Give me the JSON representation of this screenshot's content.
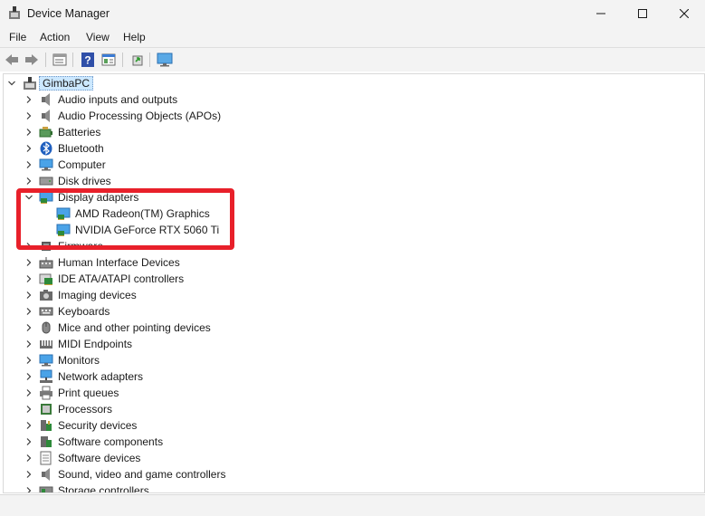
{
  "window": {
    "title": "Device Manager"
  },
  "menu": {
    "file": "File",
    "action": "Action",
    "view": "View",
    "help": "Help"
  },
  "toolbar": {
    "buttons": [
      "back-icon",
      "forward-icon",
      "properties-sheet-icon",
      "help-icon",
      "details-pane-icon",
      "update-driver-icon",
      "monitor-scan-icon"
    ]
  },
  "tree": {
    "root": "GimbaPC",
    "categories": [
      "Audio inputs and outputs",
      "Audio Processing Objects (APOs)",
      "Batteries",
      "Bluetooth",
      "Computer",
      "Disk drives",
      "Display adapters",
      "Firmware",
      "Human Interface Devices",
      "IDE ATA/ATAPI controllers",
      "Imaging devices",
      "Keyboards",
      "Mice and other pointing devices",
      "MIDI Endpoints",
      "Monitors",
      "Network adapters",
      "Print queues",
      "Processors",
      "Security devices",
      "Software components",
      "Software devices",
      "Sound, video and game controllers",
      "Storage controllers"
    ],
    "display_children": [
      "AMD Radeon(TM) Graphics",
      "NVIDIA GeForce RTX 5060 Ti"
    ]
  },
  "annotation": {
    "color": "#e8202a"
  }
}
